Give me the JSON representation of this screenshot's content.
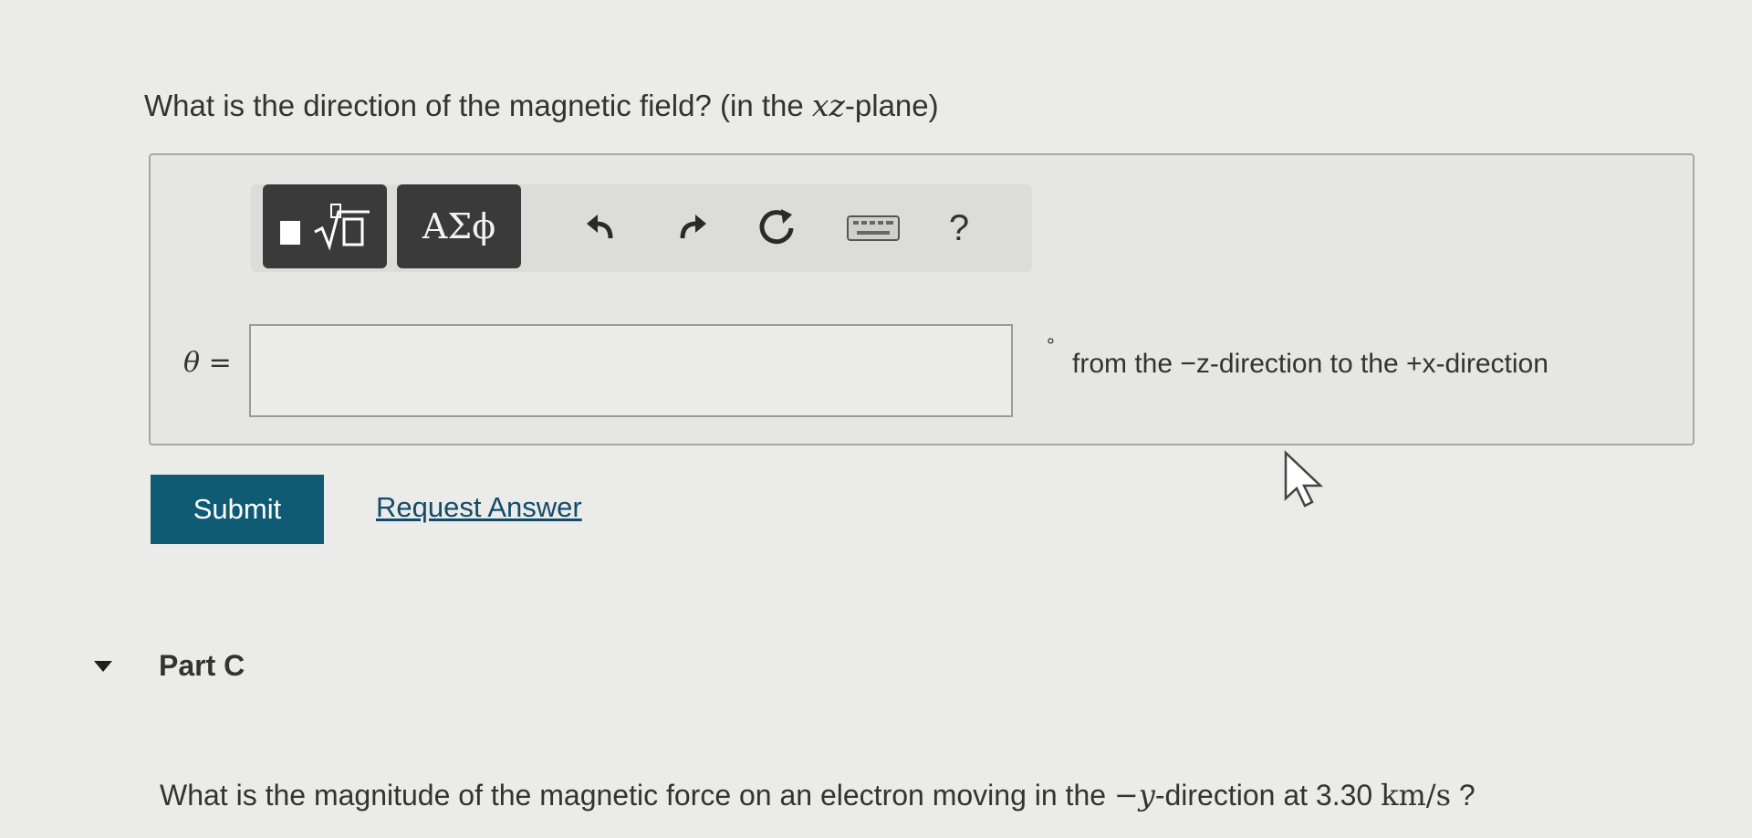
{
  "part_b": {
    "question_prefix": "What is the direction of the magnetic field? (in the ",
    "question_math": "xz",
    "question_suffix": "-plane)",
    "toolbar": {
      "greek_label": "ΑΣϕ",
      "help_label": "?"
    },
    "answer": {
      "label": "θ =",
      "value": "",
      "unit": "°",
      "direction_text": "from the −z-direction to the +x-direction"
    },
    "submit_label": "Submit",
    "request_answer_label": "Request Answer"
  },
  "part_c": {
    "title": "Part C",
    "question_prefix": "What is the magnitude of the magnetic force on an electron moving in the ",
    "question_math": "−y",
    "question_middle": "-direction at 3.30 ",
    "question_unit": "km/s",
    "question_suffix": " ?"
  },
  "colors": {
    "submit_bg": "#0e5b73",
    "link": "#144c68",
    "toolbar_button_bg": "#3a3a3a"
  },
  "icons": [
    "template-icon",
    "undo-icon",
    "redo-icon",
    "reset-icon",
    "keyboard-icon",
    "help-icon",
    "cursor-icon",
    "chevron-down-icon"
  ]
}
